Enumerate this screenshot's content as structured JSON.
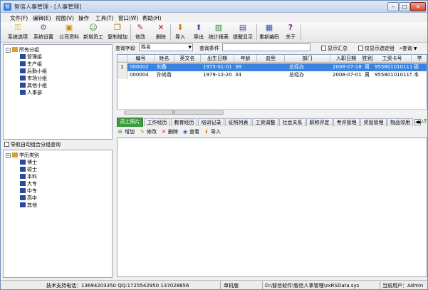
{
  "window": {
    "title": "智信人事管理 - [人事管理]"
  },
  "menu": [
    "文件(F)",
    "编辑(E)",
    "视图(V)",
    "操作",
    "工具(T)",
    "窗口(W)",
    "帮助(H)"
  ],
  "toolbar": [
    {
      "label": "系统选项",
      "icon": "key-icon"
    },
    {
      "label": "系统设置",
      "icon": "gear-icon"
    },
    {
      "label": "公司资料",
      "icon": "company-icon"
    },
    {
      "label": "新增员工",
      "icon": "add-user-icon"
    },
    {
      "label": "复制增加",
      "icon": "copy-icon"
    },
    {
      "label": "修改",
      "icon": "pencil-icon"
    },
    {
      "label": "删除",
      "icon": "delete-icon"
    },
    {
      "label": "导入",
      "icon": "import-icon"
    },
    {
      "label": "导出",
      "icon": "export-icon"
    },
    {
      "label": "统计报表",
      "icon": "report-icon"
    },
    {
      "label": "提醒显示",
      "icon": "reminder-icon"
    },
    {
      "label": "重新编码",
      "icon": "recode-icon"
    },
    {
      "label": "关于",
      "icon": "help-icon"
    }
  ],
  "tree_top": {
    "root": "所有分组",
    "group": "管理组",
    "items": [
      "生产组",
      "后勤小组",
      "市场分组",
      "其他小组",
      "人事部"
    ]
  },
  "auto_group": {
    "label": "导航自动组合分组查询"
  },
  "tree_bottom": {
    "root": "学历类别",
    "items": [
      "博士",
      "硕士",
      "本科",
      "大专",
      "中专",
      "高中",
      "其他"
    ]
  },
  "query": {
    "field_label": "查询字段",
    "field_value": "姓名",
    "cond_label": "查询条件",
    "show_summary": "显示汇总",
    "only_selected": "仅显示选定组",
    "query_button": "查询"
  },
  "grid": {
    "columns": [
      "编号",
      "姓名",
      "英文名",
      "出生日期",
      "年龄",
      "血型",
      "部门",
      "入职日期",
      "性别",
      "工资卡号",
      "学"
    ],
    "rows": [
      {
        "indicator": "1",
        "cells": [
          "000002",
          "刘备",
          "",
          "1975-01-01",
          "38",
          "",
          "总经办",
          "2008-07-18",
          "男",
          "955801010111",
          "硕"
        ]
      },
      {
        "indicator": "",
        "cells": [
          "000004",
          "孙尚香",
          "",
          "1979-12-20",
          "34",
          "",
          "总经办",
          "2008-07-01",
          "男",
          "955801010115",
          "本"
        ]
      }
    ]
  },
  "tabs": [
    "员工照片",
    "工作经历",
    "教育经历",
    "培训记录",
    "证照列表",
    "工资调整",
    "社会关系",
    "职称评定",
    "考评管理",
    "奖惩管理",
    "物品领用"
  ],
  "subtoolbar": [
    {
      "label": "增加",
      "icon": "add-icon"
    },
    {
      "label": "修改",
      "icon": "edit-icon"
    },
    {
      "label": "删除",
      "icon": "delete-icon"
    },
    {
      "label": "查看",
      "icon": "view-icon"
    },
    {
      "label": "导入",
      "icon": "import-icon"
    }
  ],
  "status": {
    "support": "技术支持电话：13694203350 QQ:1725542950 137028856",
    "mode": "单机版",
    "path": "D:\\智信软件\\智信人事管理\\zxRSData.sys",
    "user": "当前用户：Admin"
  },
  "colors": {
    "accent": "#3a83e0",
    "tab_active": "#3d9b3d",
    "title_bar": "#c4d5ea"
  }
}
